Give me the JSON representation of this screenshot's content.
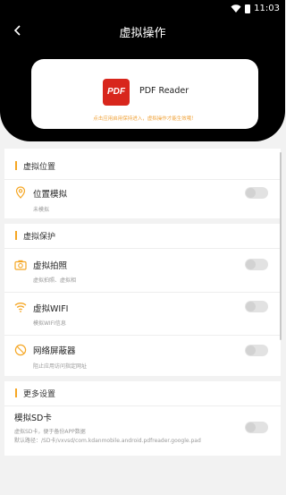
{
  "status_bar": {
    "time": "11:03"
  },
  "nav": {
    "title": "虚拟操作"
  },
  "app_card": {
    "icon_text": "PDF",
    "app_name": "PDF Reader",
    "hint": "点击应用启用保持进入，虚拟操作才能生效哦！"
  },
  "sections": {
    "location": {
      "title": "虚拟位置"
    },
    "protection": {
      "title": "虚拟保护"
    },
    "more": {
      "title": "更多设置"
    }
  },
  "rows": {
    "location_sim": {
      "title": "位置模拟",
      "sub": "未模拟",
      "enabled": false
    },
    "virtual_camera": {
      "title": "虚拟拍照",
      "sub": "虚拟拍照、虚拟相",
      "enabled": false
    },
    "virtual_wifi": {
      "title": "虚拟WIFI",
      "sub": "模拟WIFI信息",
      "enabled": false
    },
    "net_blocker": {
      "title": "网络屏蔽器",
      "sub": "阻止应用访问指定网址",
      "enabled": false
    },
    "virtual_sd": {
      "title": "模拟SD卡",
      "sub1": "虚拟SD卡，便于备份APP数据",
      "sub2": "默认路径：/SD卡/vxvsd/com.kdanmobile.android.pdfreader.google.pad",
      "enabled": false
    }
  },
  "colors": {
    "accent": "#f5a623",
    "hint": "#f0a33a",
    "header_bg": "#000000",
    "pdf_red": "#d8261c"
  },
  "icons": [
    "back-arrow-icon",
    "wifi-icon",
    "battery-icon",
    "location-pin-icon",
    "camera-icon",
    "wifi-icon",
    "block-icon"
  ]
}
